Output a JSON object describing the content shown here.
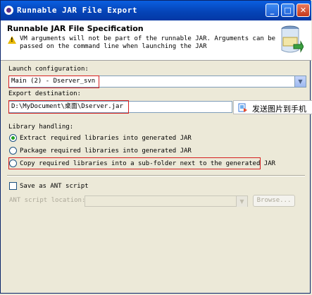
{
  "window": {
    "title": "Runnable JAR File Export",
    "buttons": {
      "minimize": "_",
      "maximize": "□",
      "close": "✕"
    }
  },
  "header": {
    "title": "Runnable JAR File Specification",
    "message": "VM arguments will not be part of the runnable JAR. Arguments can be passed on the command line when launching the JAR",
    "icon": "jar-export-wizard-icon"
  },
  "launch": {
    "label": "Launch configuration:",
    "value": "Main (2) - Dserver_svn"
  },
  "export": {
    "label": "Export destination:",
    "value": "D:\\MyDocument\\桌面\\Dserver.jar"
  },
  "library": {
    "label": "Library handling:",
    "options": [
      {
        "label": "Extract required libraries into generated JAR",
        "selected": true
      },
      {
        "label": "Package required libraries into generated JAR",
        "selected": false
      },
      {
        "label": "Copy required libraries into a sub-folder next to the generated JAR",
        "selected": false
      }
    ]
  },
  "ant": {
    "checkbox_label": "Save as ANT script",
    "checked": false,
    "location_label": "ANT script location:",
    "location_value": "",
    "browse_label": "Browse..."
  },
  "tooltip": {
    "text": "发送图片到手机"
  },
  "colors": {
    "highlight": "#d62020",
    "title_bar": "#0544b8"
  }
}
